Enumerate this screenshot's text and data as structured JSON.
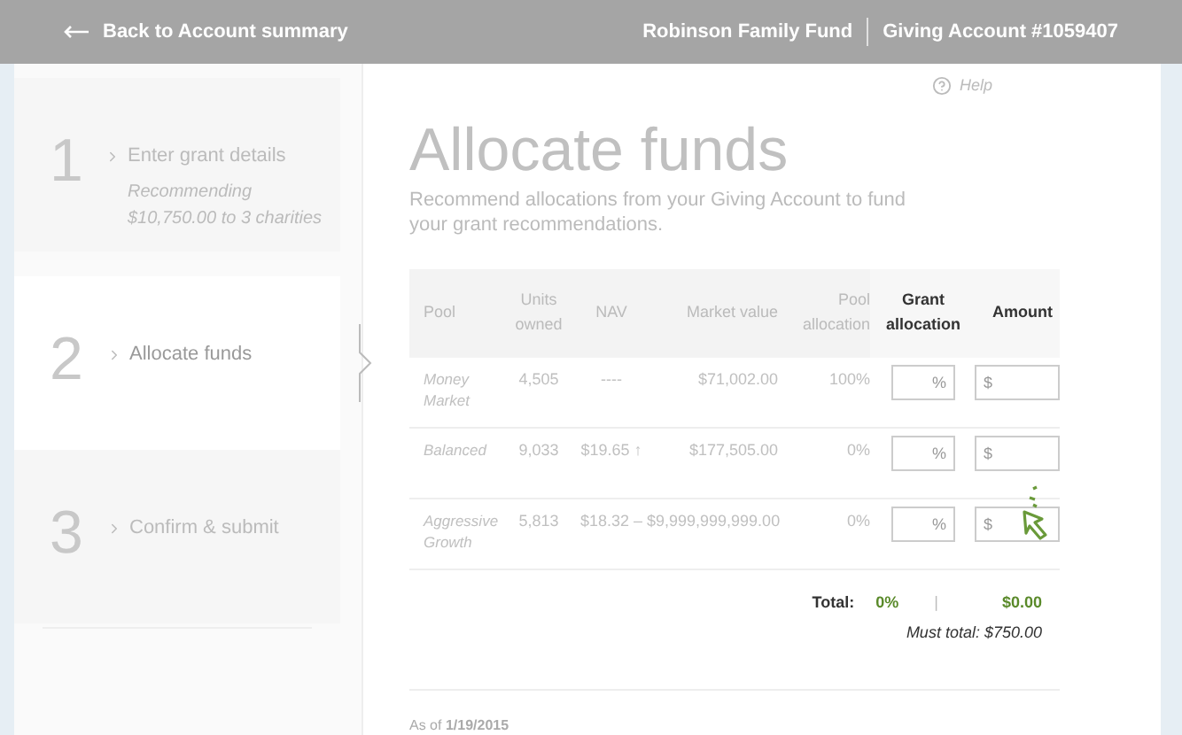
{
  "header": {
    "back": "Back to Account summary",
    "fund": "Robinson Family Fund",
    "account": "Giving Account #1059407"
  },
  "help": "Help",
  "steps": [
    {
      "number": "1",
      "label": "Enter grant details",
      "note": "Recommending $10,750.00 to 3 charities",
      "selected": false
    },
    {
      "number": "2",
      "label": "Allocate funds",
      "selected": true
    },
    {
      "number": "3",
      "label": "Confirm & submit",
      "selected": false
    }
  ],
  "title": "Allocate funds",
  "subtitle": "Recommend allocations from your Giving Account to fund your grant recommendations.",
  "table": {
    "columns": [
      "Pool",
      "Units owned",
      "NAV",
      "Market value",
      "Pool allocation",
      "Grant allocation",
      "Amount"
    ],
    "rows": [
      {
        "pool": "Money Market",
        "units": "4,505",
        "nav": "----",
        "market": "$71,002.00",
        "pool_allocation": "100%",
        "grant_placeholder": "%",
        "amount_placeholder": "$"
      },
      {
        "pool": "Balanced",
        "units": "9,033",
        "nav": "$19.65 ↑",
        "market": "$177,505.00",
        "pool_allocation": "0%",
        "grant_placeholder": "%",
        "amount_placeholder": "$"
      },
      {
        "pool": "Aggressive Growth",
        "units": "5,813",
        "nav": "$18.32 –",
        "market": "$9,999,999,999.00",
        "pool_allocation": "0%",
        "grant_placeholder": "%",
        "amount_placeholder": "$"
      }
    ]
  },
  "totals": {
    "label": "Total:",
    "percent": "0%",
    "separator": "|",
    "amount": "$0.00",
    "must_total": "Must total: $750.00"
  },
  "as_of": "As of **1/19/2015**"
}
